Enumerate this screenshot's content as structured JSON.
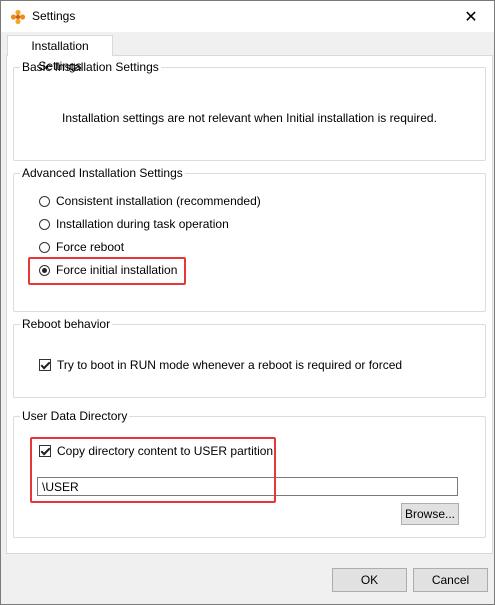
{
  "window": {
    "title": "Settings",
    "close_glyph": "✕"
  },
  "tabs": [
    {
      "label": "Installation Settings"
    }
  ],
  "basic": {
    "title": "Basic Installation Settings",
    "note": "Installation settings are not relevant when Initial installation is required."
  },
  "advanced": {
    "title": "Advanced Installation Settings",
    "options": [
      {
        "label": "Consistent installation (recommended)",
        "selected": false
      },
      {
        "label": "Installation during task operation",
        "selected": false
      },
      {
        "label": "Force reboot",
        "selected": false
      },
      {
        "label": "Force initial installation",
        "selected": true
      }
    ]
  },
  "reboot": {
    "title": "Reboot behavior",
    "checkbox_label": "Try to boot in RUN mode whenever a reboot is required or forced",
    "checked": true
  },
  "user_data": {
    "title": "User Data Directory",
    "checkbox_label": "Copy directory content to USER partition",
    "checked": true,
    "path_value": "\\USER",
    "browse_label": "Browse..."
  },
  "buttons": {
    "ok": "OK",
    "cancel": "Cancel"
  },
  "colors": {
    "highlight": "#e53935",
    "app_icon": "#f5a623"
  },
  "icons": {
    "app": "settings-app-icon",
    "close": "close-icon"
  }
}
